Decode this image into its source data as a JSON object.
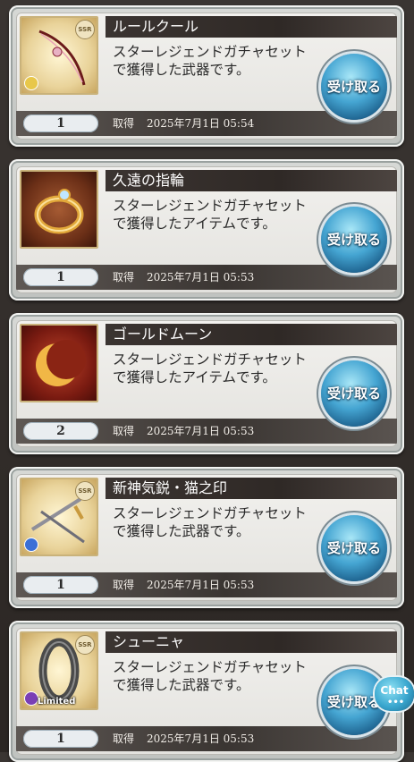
{
  "items": [
    {
      "name": "ルールクール",
      "description": "スターレジェンドガチャセットで獲得した武器です。",
      "quantity": "1",
      "acquired_label": "取得",
      "date": "2025年7月1日 05:54",
      "receive_label": "受け取る",
      "rarity": "SSR",
      "icon": "weapon-bow-icon",
      "element_color": "#e8c74a",
      "frame": "gold"
    },
    {
      "name": "久遠の指輪",
      "description": "スターレジェンドガチャセットで獲得したアイテムです。",
      "quantity": "1",
      "acquired_label": "取得",
      "date": "2025年7月1日 05:53",
      "receive_label": "受け取る",
      "rarity": "",
      "icon": "ring-icon",
      "element_color": "",
      "frame": "brown"
    },
    {
      "name": "ゴールドムーン",
      "description": "スターレジェンドガチャセットで獲得したアイテムです。",
      "quantity": "2",
      "acquired_label": "取得",
      "date": "2025年7月1日 05:53",
      "receive_label": "受け取る",
      "rarity": "",
      "icon": "crescent-moon-icon",
      "element_color": "",
      "frame": "red"
    },
    {
      "name": "新神気鋭・猫之印",
      "description": "スターレジェンドガチャセットで獲得した武器です。",
      "quantity": "1",
      "acquired_label": "取得",
      "date": "2025年7月1日 05:53",
      "receive_label": "受け取る",
      "rarity": "SSR",
      "icon": "weapon-sword-icon",
      "element_color": "#3b6fd6",
      "frame": "gold"
    },
    {
      "name": "シューニャ",
      "description": "スターレジェンドガチャセットで獲得した武器です。",
      "quantity": "1",
      "acquired_label": "取得",
      "date": "2025年7月1日 05:53",
      "receive_label": "受け取る",
      "rarity": "SSR",
      "icon": "weapon-ring-zero-icon",
      "element_color": "#7a3fb5",
      "frame": "gold",
      "badge": "Limited"
    }
  ],
  "chat": {
    "label": "Chat",
    "dots": "•••"
  }
}
